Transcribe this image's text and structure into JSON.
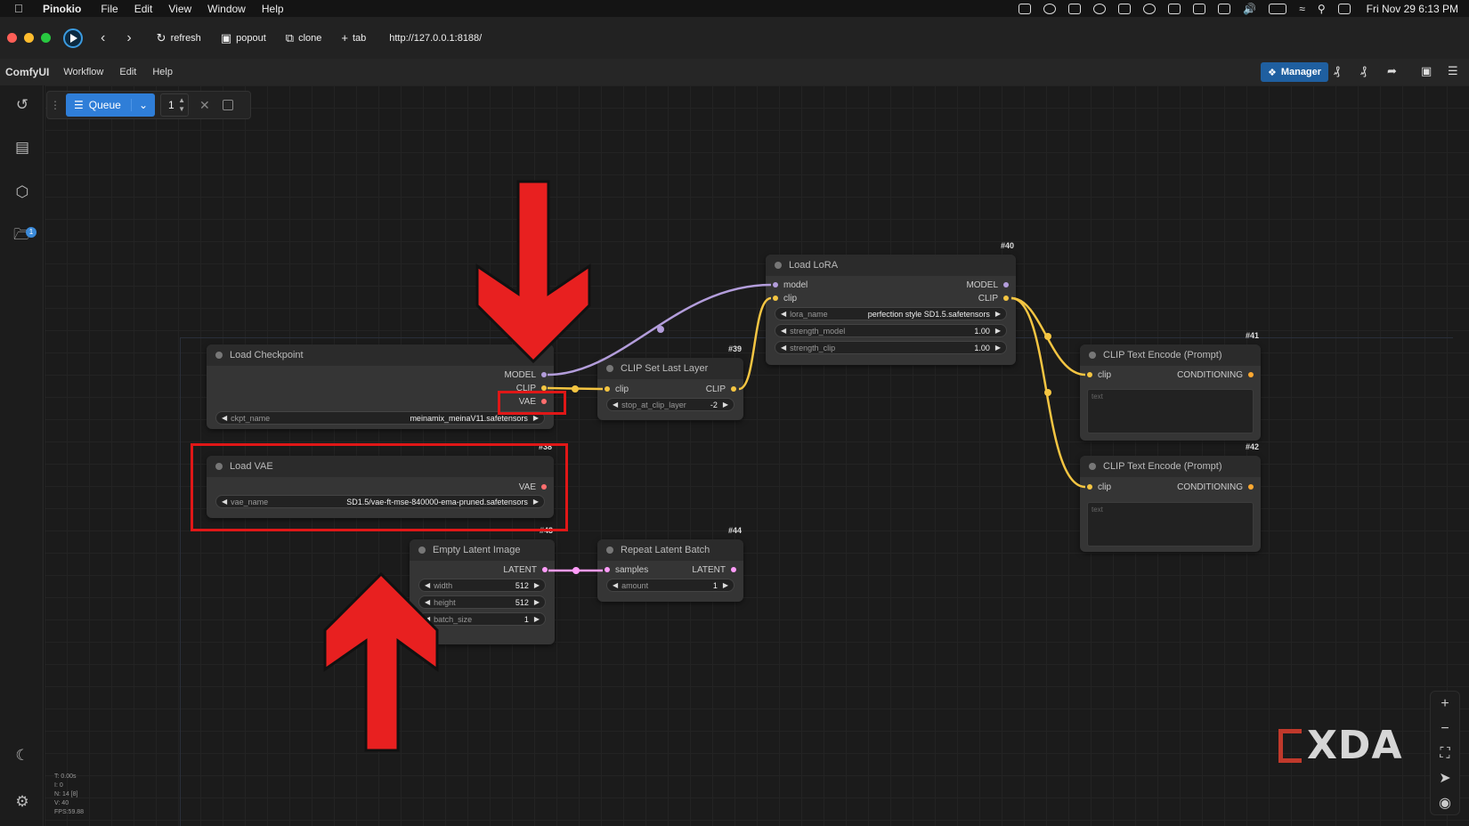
{
  "menubar": {
    "app": "Pinokio",
    "items": [
      "File",
      "Edit",
      "View",
      "Window",
      "Help"
    ],
    "clock": "Fri Nov 29  6:13 PM"
  },
  "browser": {
    "refresh": "refresh",
    "popout": "popout",
    "clone": "clone",
    "tab": "tab",
    "url": "http://127.0.0.1:8188/"
  },
  "comfy": {
    "brand": "ComfyUI",
    "menu": [
      "Workflow",
      "Edit",
      "Help"
    ],
    "manager": "Manager"
  },
  "queue": {
    "label": "Queue",
    "count": "1"
  },
  "nodes": {
    "checkpoint": {
      "title": "Load Checkpoint",
      "out_model": "MODEL",
      "out_clip": "CLIP",
      "out_vae": "VAE",
      "w_label": "ckpt_name",
      "w_value": "meinamix_meinaV11.safetensors"
    },
    "vae": {
      "id": "#38",
      "title": "Load VAE",
      "out_vae": "VAE",
      "w_label": "vae_name",
      "w_value": "SD1.5/vae-ft-mse-840000-ema-pruned.safetensors"
    },
    "clipset": {
      "id": "#39",
      "title": "CLIP Set Last Layer",
      "in_clip": "clip",
      "out_clip": "CLIP",
      "w_label": "stop_at_clip_layer",
      "w_value": "-2"
    },
    "lora": {
      "id": "#40",
      "title": "Load LoRA",
      "in_model": "model",
      "in_clip": "clip",
      "out_model": "MODEL",
      "out_clip": "CLIP",
      "w1_label": "lora_name",
      "w1_value": "perfection style SD1.5.safetensors",
      "w2_label": "strength_model",
      "w2_value": "1.00",
      "w3_label": "strength_clip",
      "w3_value": "1.00"
    },
    "enc1": {
      "id": "#41",
      "title": "CLIP Text Encode (Prompt)",
      "in_clip": "clip",
      "out": "CONDITIONING",
      "placeholder": "text"
    },
    "enc2": {
      "id": "#42",
      "title": "CLIP Text Encode (Prompt)",
      "in_clip": "clip",
      "out": "CONDITIONING",
      "placeholder": "text"
    },
    "latent": {
      "id": "#43",
      "title": "Empty Latent Image",
      "out": "LATENT",
      "w1_label": "width",
      "w1_value": "512",
      "w2_label": "height",
      "w2_value": "512",
      "w3_label": "batch_size",
      "w3_value": "1"
    },
    "repeat": {
      "id": "#44",
      "title": "Repeat Latent Batch",
      "in": "samples",
      "out": "LATENT",
      "w_label": "amount",
      "w_value": "1"
    }
  },
  "stats": [
    "T: 0.00s",
    "I: 0",
    "N: 14 [8]",
    "V: 40",
    "FPS:59.88"
  ],
  "sidebar_badge": "1",
  "watermark": "XDA",
  "colors": {
    "model": "#b39ddb",
    "clip": "#f4c542",
    "vae": "#ff6e6e",
    "latent": "#ff9cf9",
    "accent": "#2f7ed8",
    "annotation": "#e01717"
  }
}
